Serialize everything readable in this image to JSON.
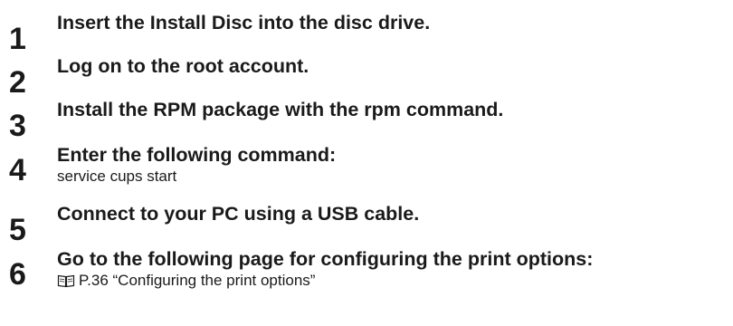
{
  "steps": [
    {
      "number": "1",
      "title": "Insert the Install Disc into the disc drive."
    },
    {
      "number": "2",
      "title": "Log on to the root account."
    },
    {
      "number": "3",
      "title": "Install the RPM package with the rpm command."
    },
    {
      "number": "4",
      "title": "Enter the following command:",
      "detail": "service cups start"
    },
    {
      "number": "5",
      "title": "Connect to your PC using a USB cable."
    },
    {
      "number": "6",
      "title": "Go to the following page for configuring the print options:",
      "reference": {
        "icon": "book-icon",
        "text": "P.36 “Configuring the print options”"
      }
    }
  ]
}
